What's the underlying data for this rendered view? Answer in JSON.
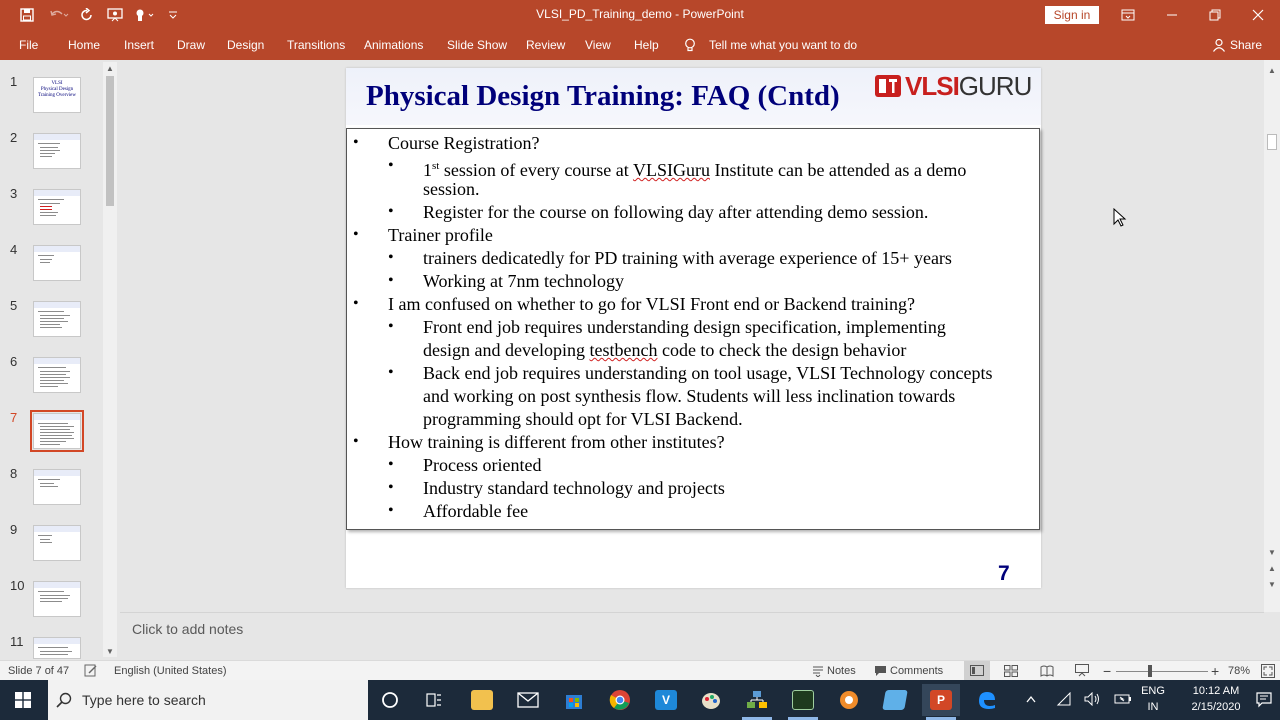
{
  "window": {
    "title": "VLSI_PD_Training_demo  -  PowerPoint",
    "signin_label": "Sign in",
    "minimize_glyph": "—",
    "restore_glyph": "❐",
    "close_glyph": "✕",
    "ribbon_display_glyph": "▭"
  },
  "quick_access": {
    "icons": [
      "save-icon",
      "undo-icon",
      "redo-icon",
      "present-icon",
      "touch-mode-icon",
      "customize-icon"
    ]
  },
  "ribbon": {
    "tabs": [
      "File",
      "Home",
      "Insert",
      "Draw",
      "Design",
      "Transitions",
      "Animations",
      "Slide Show",
      "Review",
      "View",
      "Help"
    ],
    "tell_me": "Tell me what you want to do",
    "share": "Share"
  },
  "thumbnails": {
    "numbers": [
      "1",
      "2",
      "3",
      "4",
      "5",
      "6",
      "7",
      "8",
      "9",
      "10",
      "11"
    ],
    "selected": "7",
    "first_thumb_text": "VLSI\nPhysical Design\nTraining Overview"
  },
  "slide": {
    "title": "Physical Design Training: FAQ (Cntd)",
    "logo_v": "VLSI",
    "logo_g": "GURU",
    "number": "7",
    "bullet": "•",
    "lines": {
      "l1": "Course Registration?",
      "l2a_sup": "st",
      "l2a_pre": "1",
      "l2a_mid": " session of every course at ",
      "l2a_wavy": "VLSIGuru",
      "l2a_end": " Institute can be attended as a demo",
      "l2b": "session.",
      "l3": "Register for the course on following day after attending demo session.",
      "l4": "Trainer profile",
      "l5": "trainers dedicatedly for PD training with average experience of 15+ years",
      "l6": "Working at 7nm technology",
      "l7": "I am confused on whether to go for VLSI Front end or Backend training?",
      "l8a": "Front end job requires understanding design specification, implementing",
      "l8b_pre": "design and developing ",
      "l8b_wavy": "testbench",
      "l8b_end": " code to check the design behavior",
      "l9a": "Back end job requires understanding on tool usage, VLSI Technology concepts",
      "l9b": "and working on post synthesis flow. Students will less inclination towards",
      "l9c": "programming should opt for VLSI Backend.",
      "l10": "How training is different from other institutes?",
      "l11": "Process oriented",
      "l12": "Industry standard technology and projects",
      "l13": "Affordable fee"
    }
  },
  "notes": {
    "placeholder": "Click to add notes"
  },
  "statusbar": {
    "slide_counter": "Slide 7 of 47",
    "language": "English (United States)",
    "notes": "Notes",
    "comments": "Comments",
    "zoom": "78%",
    "zoom_level": 0.78
  },
  "taskbar": {
    "search_placeholder": "Type here to search",
    "lang_line1": "ENG",
    "lang_line2": "IN",
    "time": "10:12 AM",
    "date": "2/15/2020",
    "apps": [
      "cortana-icon",
      "task-view-icon",
      "file-explorer-icon",
      "mail-icon",
      "store-icon",
      "chrome-icon",
      "vscode-icon",
      "paint-icon",
      "network-app-icon",
      "terminal-icon",
      "settings-app-icon",
      "notepad-icon",
      "powerpoint-icon",
      "edge-icon"
    ]
  },
  "colors": {
    "ribbon": "#b7472a",
    "title_text": "#00007a",
    "selection_outline": "#d24726",
    "logo_red": "#c8201e"
  }
}
